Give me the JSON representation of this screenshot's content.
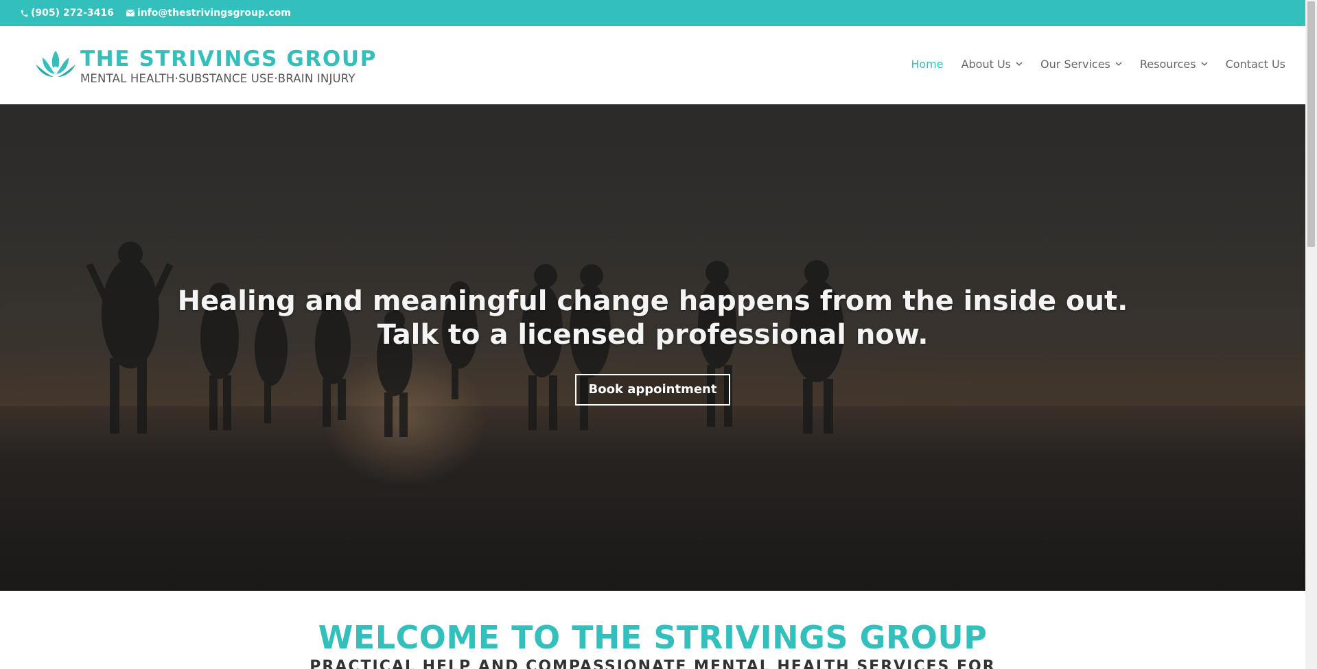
{
  "topbar": {
    "phone": "(905) 272-3416",
    "email": "info@thestrivingsgroup.com"
  },
  "header": {
    "logo_name": "THE STRIVINGS GROUP",
    "logo_tagline": "MENTAL HEALTH·SUBSTANCE USE·BRAIN INJURY",
    "nav": {
      "home": "Home",
      "about": "About Us",
      "services": "Our Services",
      "resources": "Resources",
      "contact": "Contact Us"
    }
  },
  "hero": {
    "title": "Healing and meaningful change happens from the inside out. Talk to a licensed professional now.",
    "button_label": "Book appointment"
  },
  "welcome": {
    "title": "WELCOME TO THE STRIVINGS GROUP",
    "subtitle": "PRACTICAL HELP AND COMPASSIONATE MENTAL HEALTH SERVICES FOR"
  },
  "colors": {
    "accent": "#33bfbc",
    "nav_text": "#666666",
    "hero_bg": "#1d1c1b"
  }
}
